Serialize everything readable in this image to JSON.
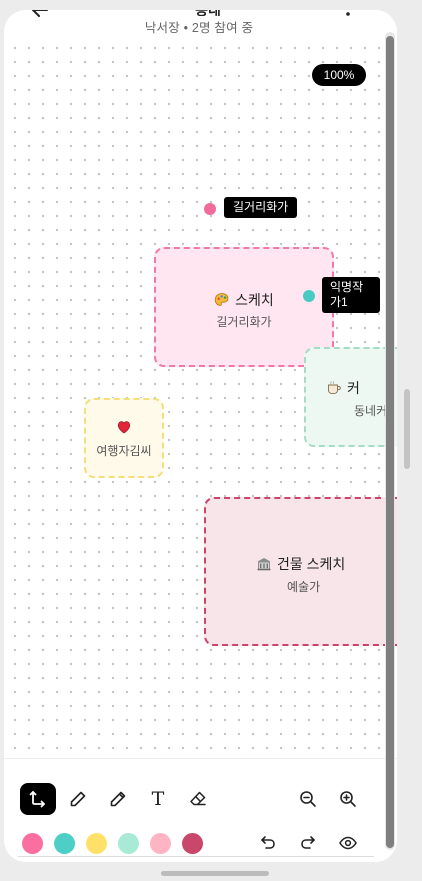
{
  "header": {
    "title": "동네",
    "subtitle": "낙서장 • 2명 참여 중",
    "back_icon": "arrow-left-icon",
    "more_icon": "more-vertical-icon"
  },
  "canvas": {
    "zoom": "100%",
    "cursors": [
      {
        "name": "길거리화가",
        "color": "#f06b9a"
      },
      {
        "name": "익명작\n가1",
        "color": "#49cbc4"
      }
    ],
    "notes": [
      {
        "title": "스케치",
        "author": "길거리화가",
        "icon": "palette-icon",
        "fill": "#ffe6f1",
        "border": "#ef7aa8"
      },
      {
        "title": "커",
        "author": "동네커",
        "icon": "coffee-icon",
        "fill": "#eef8f3",
        "border": "#a6dcc6"
      },
      {
        "title": "",
        "author": "여행자김씨",
        "icon": "heart-icon",
        "fill": "#fffaea",
        "border": "#f5de7c"
      },
      {
        "title": "건물 스케치",
        "author": "예술가",
        "icon": "building-icon",
        "fill": "#f7e5ea",
        "border": "#c9456b"
      }
    ]
  },
  "toolbar": {
    "tools": [
      {
        "name": "connector-tool",
        "icon": "connector-icon",
        "active": true
      },
      {
        "name": "pen-tool",
        "icon": "pen-icon",
        "active": false
      },
      {
        "name": "pencil-tool",
        "icon": "pencil-icon",
        "active": false
      },
      {
        "name": "text-tool",
        "icon": "text-icon",
        "active": false
      },
      {
        "name": "eraser-tool",
        "icon": "eraser-icon",
        "active": false
      }
    ],
    "zoom_out_icon": "zoom-out-icon",
    "zoom_in_icon": "zoom-in-icon",
    "text_icon_glyph": "T",
    "colors": [
      "#fb6fa0",
      "#4dcfc8",
      "#ffe16a",
      "#a8ead6",
      "#ffb4c4",
      "#c8476a"
    ],
    "undo_icon": "undo-icon",
    "redo_icon": "redo-icon",
    "view_icon": "eye-icon"
  }
}
